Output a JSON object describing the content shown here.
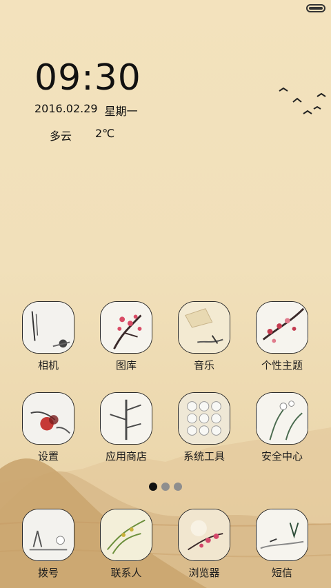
{
  "clock": {
    "time": "09:30",
    "date": "2016.02.29",
    "weekday": "星期一",
    "weather": "多云",
    "temp": "2℃"
  },
  "apps": {
    "camera": "相机",
    "gallery": "图库",
    "music": "音乐",
    "themes": "个性主题",
    "settings": "设置",
    "store": "应用商店",
    "tools": "系统工具",
    "security": "安全中心"
  },
  "dock": {
    "dialer": "拨号",
    "contacts": "联系人",
    "browser": "浏览器",
    "sms": "短信"
  },
  "pager": {
    "pages": 3,
    "current": 1
  },
  "colors": {
    "background": "#f1e0ba",
    "accent": "#c74a5a",
    "ink": "#2b2b2b"
  }
}
